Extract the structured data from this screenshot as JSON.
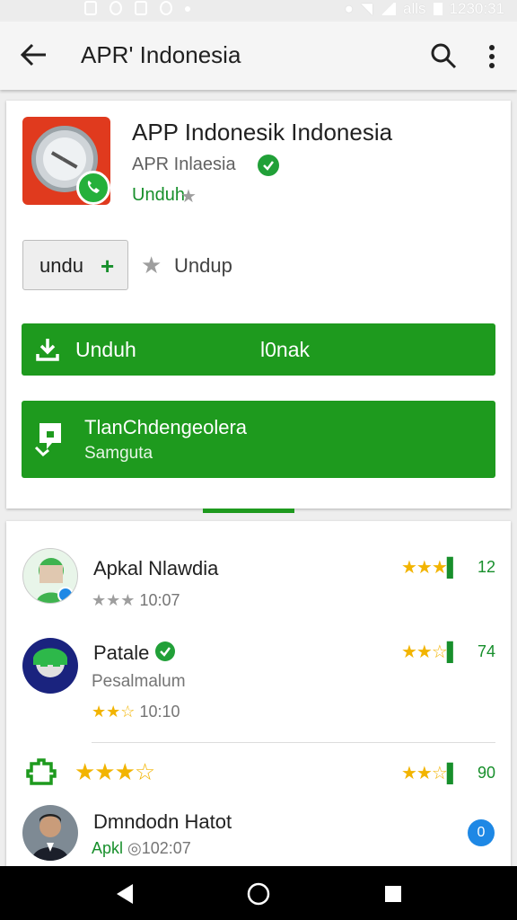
{
  "status": {
    "time": "1230:31",
    "label": "alls"
  },
  "toolbar": {
    "title": "APR' Indonesia"
  },
  "app": {
    "name": "APP Indonesik Indonesia",
    "developer": "APR Inlaesia",
    "tag": "Unduh"
  },
  "actions": {
    "secondary_label": "undu",
    "wishlist_label": "Undup",
    "install_label": "Unduh",
    "install_right": "l0nak",
    "second_title": "TlanChdengeolera",
    "second_sub": "Samguta"
  },
  "reviews": [
    {
      "name": "Apkal Nlawdia",
      "meta": "10:07",
      "count": "12"
    },
    {
      "name": "Patale",
      "meta_line": "Pesalmalum",
      "meta": "10:10",
      "count": "74"
    },
    {
      "name": "",
      "count": "90"
    },
    {
      "name": "Dmndodn Hatot",
      "meta": "Apkl",
      "meta2": "102:07",
      "badge": "0"
    }
  ],
  "colors": {
    "accent": "#1e9a1e",
    "star": "#f2b400",
    "link_green": "#178f2b"
  }
}
